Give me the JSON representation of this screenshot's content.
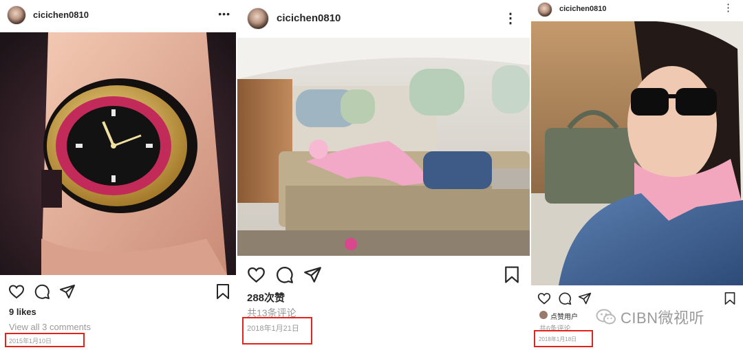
{
  "posts": [
    {
      "username": "cicichen0810",
      "more": "•••",
      "likes": "9 likes",
      "comments": "View all 3 comments",
      "date": "2015年1月10日"
    },
    {
      "username": "cicichen0810",
      "more": "⋮",
      "likes": "288次赞",
      "comments": "共13条评论",
      "date": "2018年1月21日"
    },
    {
      "username": "cicichen0810",
      "more": "⋮",
      "liked_by": "点赞用户",
      "comments": "共6条评论",
      "date": "2018年1月18日"
    }
  ],
  "watermark": {
    "text": "CIBN微视听",
    "icon": "wechat-icon"
  },
  "colors": {
    "highlight": "#e0241c",
    "text": "#262626",
    "muted": "#999999"
  }
}
